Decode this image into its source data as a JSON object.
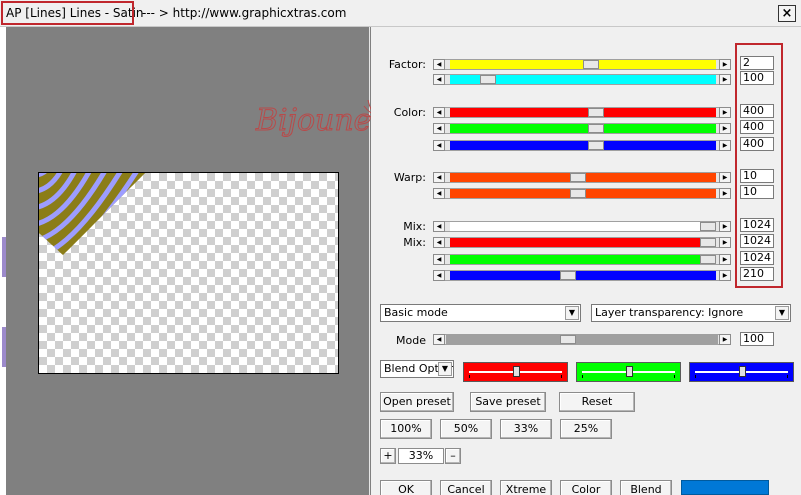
{
  "window": {
    "title": "AP [Lines]  Lines - Satin",
    "url": "--- > http://www.graphicxtras.com",
    "close": "×"
  },
  "watermark": {
    "text": "Bijounet"
  },
  "labels": {
    "factor": "Factor:",
    "color": "Color:",
    "warp": "Warp:",
    "mix1": "Mix:",
    "mix2": "Mix:",
    "mode": "Mode"
  },
  "sliders": [
    {
      "id": "factor-1",
      "color": "#ffff00",
      "position": 0.53,
      "value": "2"
    },
    {
      "id": "factor-2",
      "color": "#00ffff",
      "position": 0.12,
      "value": "100"
    },
    {
      "id": "color-red",
      "color": "#ff0000",
      "position": 0.55,
      "value": "400"
    },
    {
      "id": "color-green",
      "color": "#00ff00",
      "position": 0.55,
      "value": "400"
    },
    {
      "id": "color-blue",
      "color": "#0000ff",
      "position": 0.55,
      "value": "400"
    },
    {
      "id": "warp-1",
      "color": "#ff4500",
      "position": 0.48,
      "value": "10"
    },
    {
      "id": "warp-2",
      "color": "#ff4500",
      "position": 0.48,
      "value": "10"
    },
    {
      "id": "mix-white",
      "color": "#ffffff",
      "position": 1.0,
      "value": "1024"
    },
    {
      "id": "mix-red",
      "color": "#ff0000",
      "position": 1.0,
      "value": "1024"
    },
    {
      "id": "mix-green",
      "color": "#00ff00",
      "position": 1.0,
      "value": "1024"
    },
    {
      "id": "mix-blue",
      "color": "#0000ff",
      "position": 0.44,
      "value": "210"
    }
  ],
  "dropdowns": {
    "mode": "Basic mode",
    "transparency": "Layer transparency: Ignore",
    "blend": "Blend Options"
  },
  "mode_slider": {
    "position": 0.45,
    "value": "100"
  },
  "color_boxes": [
    {
      "color": "#ff0000",
      "position": 0.5
    },
    {
      "color": "#00ff00",
      "position": 0.5
    },
    {
      "color": "#0000ff",
      "position": 0.5
    }
  ],
  "buttons": {
    "open_preset": "Open preset",
    "save_preset": "Save preset",
    "reset": "Reset",
    "zoom_100": "100%",
    "zoom_50": "50%",
    "zoom_33": "33%",
    "zoom_25": "25%",
    "zoom_plus": "+",
    "zoom_minus": "–",
    "zoom_value": "33%",
    "ok": "OK",
    "cancel": "Cancel",
    "xtreme": "Xtreme",
    "color": "Color",
    "blend": "Blend"
  },
  "colors": {
    "accent": "#0078d7",
    "highlight": "#c0272d",
    "preview_stripe_dark": "#8b7d18",
    "preview_stripe_light": "#9d9dff"
  }
}
